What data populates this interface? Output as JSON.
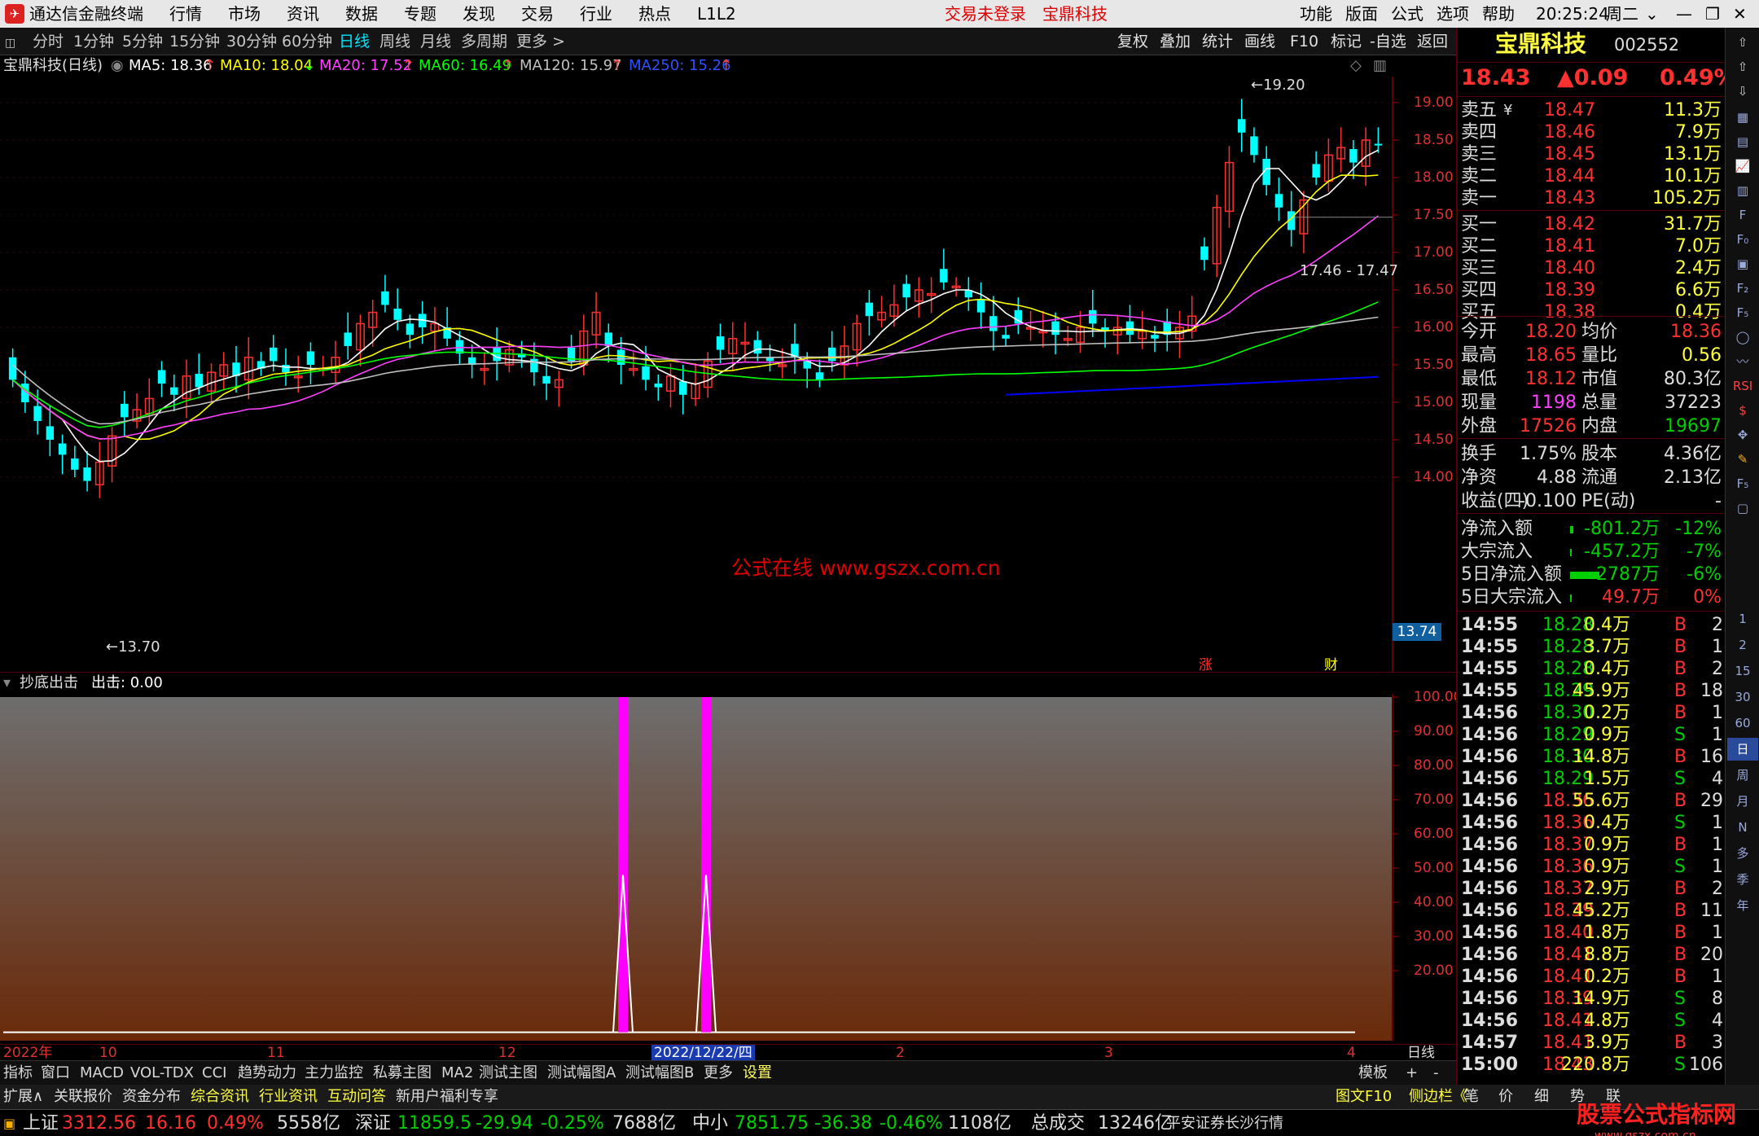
{
  "app": {
    "title": "通达信金融终端",
    "menu": [
      "行情",
      "市场",
      "资讯",
      "数据",
      "专题",
      "发现",
      "交易",
      "行业",
      "热点",
      "L1L2"
    ],
    "login_status": "交易未登录",
    "stock_name_title": "宝鼎科技",
    "right_menu": [
      "功能",
      "版面",
      "公式",
      "选项",
      "帮助"
    ],
    "time": "20:25:24",
    "weekday": "周二"
  },
  "periods": {
    "items": [
      "分时",
      "1分钟",
      "5分钟",
      "15分钟",
      "30分钟",
      "60分钟",
      "日线",
      "周线",
      "月线",
      "多周期",
      "更多 >"
    ],
    "active": "日线"
  },
  "toolbar": {
    "buttons": [
      "复权",
      "叠加",
      "统计",
      "画线",
      "F10",
      "标记",
      "-自选",
      "返回"
    ]
  },
  "chart_header": {
    "name": "宝鼎科技(日线)",
    "ma": [
      {
        "label": "MA5: 18.36",
        "color": "#ffffff"
      },
      {
        "label": "MA10: 18.04",
        "color": "#ffff00"
      },
      {
        "label": "MA20: 17.52",
        "color": "#ff40ff"
      },
      {
        "label": "MA60: 16.49",
        "color": "#00ff00"
      },
      {
        "label": "MA120: 15.97",
        "color": "#c0c0c0"
      },
      {
        "label": "MA250: 15.26",
        "color": "#0000ff"
      }
    ]
  },
  "price_axis": [
    "19.00",
    "18.50",
    "18.00",
    "17.50",
    "17.00",
    "16.50",
    "16.00",
    "15.50",
    "15.00",
    "14.50",
    "14.00"
  ],
  "current_price_tag": "13.74",
  "annotations": {
    "high": "19.20",
    "low": "13.70",
    "range": "17.46 - 17.47",
    "watermark": "公式在线  www.gszx.com.cn",
    "mark1": "涨",
    "mark2": "财"
  },
  "indicator": {
    "name": "抄底出击",
    "value_label": "出击: 0.00",
    "axis": [
      "100.00",
      "90.00",
      "80.00",
      "70.00",
      "60.00",
      "50.00",
      "40.00",
      "30.00",
      "20.00"
    ]
  },
  "date_axis": {
    "labels": [
      "2022年",
      "10",
      "11",
      "12",
      "2022/12/22/四",
      "2",
      "3",
      "4"
    ],
    "right_label": "日线"
  },
  "bottom_tabs": [
    "指标",
    "窗口",
    "MACD",
    "VOL-TDX",
    "CCI",
    "趋势动力",
    "主力监控",
    "私募主图",
    "MA2",
    "测试主图",
    "测试幅图A",
    "测试幅图B",
    "更多",
    "设置"
  ],
  "bottom_right_tabs": [
    "模板",
    "+",
    "-"
  ],
  "bottom_tabs2": [
    "扩展∧",
    "关联报价",
    "资金分布",
    "综合资讯",
    "行业资讯",
    "互动问答",
    "新用户福利专享"
  ],
  "bottom_tabs2_right": [
    "图文F10",
    "侧边栏《",
    "笔",
    "价",
    "细",
    "势",
    "联"
  ],
  "status": {
    "sh": {
      "name": "上证",
      "price": "3312.56",
      "chg": "16.16",
      "pct": "0.49%",
      "amt": "5558亿"
    },
    "sz": {
      "name": "深证",
      "price": "11859.5",
      "chg": "-29.94",
      "pct": "-0.25%",
      "amt": "7688亿"
    },
    "zx": {
      "name": "中小",
      "price": "7851.75",
      "chg": "-36.38",
      "pct": "-0.46%",
      "amt": "1108亿"
    },
    "total": {
      "label": "总成交",
      "amt": "13246亿",
      "extra": "平安证券长沙行情"
    },
    "brand": "股票公式指标网",
    "brand_url": "www.gszx.com.cn"
  },
  "quote": {
    "name": "宝鼎科技",
    "code": "002552",
    "price": "18.43",
    "change": "▲0.09",
    "pct": "0.49%",
    "asks": [
      {
        "label": "卖五",
        "mark": "¥",
        "price": "18.47",
        "vol": "11.3万"
      },
      {
        "label": "卖四",
        "price": "18.46",
        "vol": "7.9万"
      },
      {
        "label": "卖三",
        "price": "18.45",
        "vol": "13.1万"
      },
      {
        "label": "卖二",
        "price": "18.44",
        "vol": "10.1万"
      },
      {
        "label": "卖一",
        "price": "18.43",
        "vol": "105.2万"
      }
    ],
    "bids": [
      {
        "label": "买一",
        "price": "18.42",
        "vol": "31.7万"
      },
      {
        "label": "买二",
        "price": "18.41",
        "vol": "7.0万"
      },
      {
        "label": "买三",
        "price": "18.40",
        "vol": "2.4万"
      },
      {
        "label": "买四",
        "price": "18.39",
        "vol": "6.6万"
      },
      {
        "label": "买五",
        "price": "18.38",
        "vol": "0.4万"
      }
    ],
    "stats": [
      {
        "l1": "今开",
        "v1": "18.20",
        "l2": "均价",
        "v2": "18.36"
      },
      {
        "l1": "最高",
        "v1": "18.65",
        "l2": "量比",
        "v2": "0.56"
      },
      {
        "l1": "最低",
        "v1": "18.12",
        "l2": "市值",
        "v2": "80.3亿"
      },
      {
        "l1": "现量",
        "v1": "1198",
        "l2": "总量",
        "v2": "37223"
      },
      {
        "l1": "外盘",
        "v1": "17526",
        "l2": "内盘",
        "v2": "19697"
      }
    ],
    "stats2": [
      {
        "l1": "换手",
        "v1": "1.75%",
        "l2": "股本",
        "v2": "4.36亿"
      },
      {
        "l1": "净资",
        "v1": "4.88",
        "l2": "流通",
        "v2": "2.13亿"
      },
      {
        "l1": "收益(四)",
        "v1": "-0.100",
        "l2": "PE(动)",
        "v2": "-"
      }
    ],
    "flows": [
      {
        "label": "净流入额",
        "value": "-801.2万",
        "pct": "-12%",
        "bar": 0.1
      },
      {
        "label": "大宗流入",
        "value": "-457.2万",
        "pct": "-7%",
        "bar": 0.05
      },
      {
        "label": "5日净流入额",
        "value": "-2787万",
        "pct": "-6%",
        "bar": 0.9
      },
      {
        "label": "5日大宗流入",
        "value": "49.7万",
        "pct": "0%",
        "bar": 0.02
      }
    ],
    "ticks": [
      {
        "t": "14:55",
        "p": "18.28",
        "v": "0.4万",
        "d": "B",
        "n": "2"
      },
      {
        "t": "14:55",
        "p": "18.28",
        "v": "3.7万",
        "d": "B",
        "n": "1"
      },
      {
        "t": "14:55",
        "p": "18.28",
        "v": "0.4万",
        "d": "B",
        "n": "2"
      },
      {
        "t": "14:55",
        "p": "18.29",
        "v": "45.9万",
        "d": "B",
        "n": "18"
      },
      {
        "t": "14:56",
        "p": "18.30",
        "v": "0.2万",
        "d": "B",
        "n": "1"
      },
      {
        "t": "14:56",
        "p": "18.29",
        "v": "0.9万",
        "d": "S",
        "n": "1"
      },
      {
        "t": "14:56",
        "p": "18.30",
        "v": "14.8万",
        "d": "B",
        "n": "16"
      },
      {
        "t": "14:56",
        "p": "18.29",
        "v": "1.5万",
        "d": "S",
        "n": "4"
      },
      {
        "t": "14:56",
        "p": "18.36",
        "v": "55.6万",
        "d": "B",
        "n": "29"
      },
      {
        "t": "14:56",
        "p": "18.36",
        "v": "0.4万",
        "d": "S",
        "n": "1"
      },
      {
        "t": "14:56",
        "p": "18.37",
        "v": "0.9万",
        "d": "B",
        "n": "1"
      },
      {
        "t": "14:56",
        "p": "18.36",
        "v": "0.9万",
        "d": "S",
        "n": "1"
      },
      {
        "t": "14:56",
        "p": "18.37",
        "v": "2.9万",
        "d": "B",
        "n": "2"
      },
      {
        "t": "14:56",
        "p": "18.39",
        "v": "45.2万",
        "d": "B",
        "n": "11"
      },
      {
        "t": "14:56",
        "p": "18.40",
        "v": "1.8万",
        "d": "B",
        "n": "1"
      },
      {
        "t": "14:56",
        "p": "18.41",
        "v": "8.8万",
        "d": "B",
        "n": "20"
      },
      {
        "t": "14:56",
        "p": "18.41",
        "v": "0.2万",
        "d": "B",
        "n": "1"
      },
      {
        "t": "14:56",
        "p": "18.39",
        "v": "14.9万",
        "d": "S",
        "n": "8"
      },
      {
        "t": "14:56",
        "p": "18.41",
        "v": "4.8万",
        "d": "S",
        "n": "4"
      },
      {
        "t": "14:57",
        "p": "18.41",
        "v": "3.9万",
        "d": "B",
        "n": "3"
      },
      {
        "t": "15:00",
        "p": "18.43",
        "v": "220.8万",
        "d": "S",
        "n": "106"
      }
    ]
  },
  "sidebar": [
    "1",
    "2",
    "15",
    "30",
    "60",
    "日",
    "周",
    "月",
    "N",
    "多",
    "季",
    "年"
  ],
  "colors": {
    "up": "#ff3030",
    "down": "#00ffff",
    "ma5": "#ffffff",
    "ma10": "#ffff00",
    "ma20": "#ff40ff",
    "ma60": "#00ff00",
    "ma120": "#c0c0c0",
    "ma250": "#0000ff",
    "signal": "#ff00ff"
  }
}
